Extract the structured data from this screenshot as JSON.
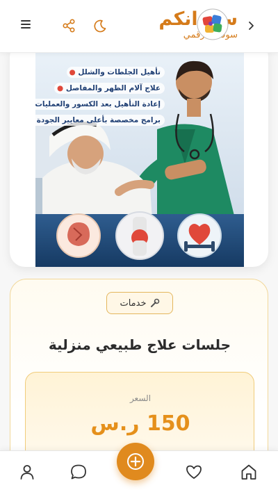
{
  "header": {
    "brand_title": "سودانكم",
    "brand_subtitle": "سوقك الرقمي",
    "accent_color": "#d57b1a",
    "icons": [
      "menu-icon",
      "share-icon",
      "moon-icon",
      "logo",
      "chevron-right-icon"
    ]
  },
  "banner": {
    "bullets": [
      "تأهيل الجلطات والشلل",
      "علاج آلام الظهر والمفاصل",
      "إعادة التأهيل بعد الكسور والعمليات",
      "برامج مخصصة بأعلى معايير الجودة"
    ]
  },
  "product": {
    "category_badge": "خدمات",
    "title": "جلسات علاج طبيعي منزلية",
    "price_label": "السعر",
    "price_value": "150 ر.س"
  },
  "bottom_nav": {
    "items": [
      "user-icon",
      "chat-icon",
      "add-icon",
      "heart-icon",
      "home-icon"
    ],
    "fab_color": "#e08a1e"
  }
}
